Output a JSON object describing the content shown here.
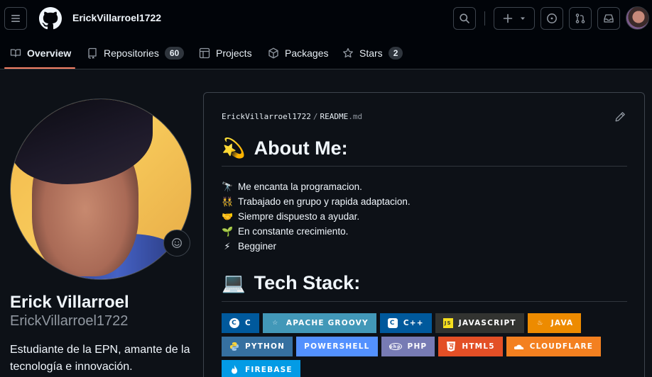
{
  "header": {
    "username": "ErickVillarroel1722"
  },
  "tabs": [
    {
      "label": "Overview"
    },
    {
      "label": "Repositories",
      "count": "60"
    },
    {
      "label": "Projects"
    },
    {
      "label": "Packages"
    },
    {
      "label": "Stars",
      "count": "2"
    }
  ],
  "profile": {
    "full_name": "Erick Villarroel",
    "login": "ErickVillarroel1722",
    "bio": "Estudiante de la EPN, amante de la tecnología e innovación."
  },
  "readme": {
    "path_owner": "ErickVillarroel1722",
    "path_sep": "/",
    "path_file": "README",
    "path_ext": ".md",
    "about_title": "About Me:",
    "about_emoji": "💫",
    "about_items": [
      {
        "emoji": "🔭",
        "text": "Me encanta la programacion."
      },
      {
        "emoji": "👯",
        "text": "Trabajado en grupo y rapida adaptacion."
      },
      {
        "emoji": "🤝",
        "text": "Siempre dispuesto a ayudar."
      },
      {
        "emoji": "🌱",
        "text": "En constante crecimiento."
      },
      {
        "emoji": "⚡",
        "text": "Begginer"
      }
    ],
    "stack_title": "Tech Stack:",
    "stack_emoji": "💻",
    "badges": [
      {
        "label": "C",
        "color": "#00599C"
      },
      {
        "label": "APACHE GROOVY",
        "color": "#4298B8"
      },
      {
        "label": "C++",
        "color": "#00599C"
      },
      {
        "label": "JAVASCRIPT",
        "color": "#323330"
      },
      {
        "label": "JAVA",
        "color": "#ED8B00"
      },
      {
        "label": "PYTHON",
        "color": "#3670A0"
      },
      {
        "label": "POWERSHELL",
        "color": "#5391FE"
      },
      {
        "label": "PHP",
        "color": "#777BB4"
      },
      {
        "label": "HTML5",
        "color": "#E34F26"
      },
      {
        "label": "CLOUDFLARE",
        "color": "#F38020"
      },
      {
        "label": "FIREBASE",
        "color": "#039BE5"
      }
    ]
  }
}
